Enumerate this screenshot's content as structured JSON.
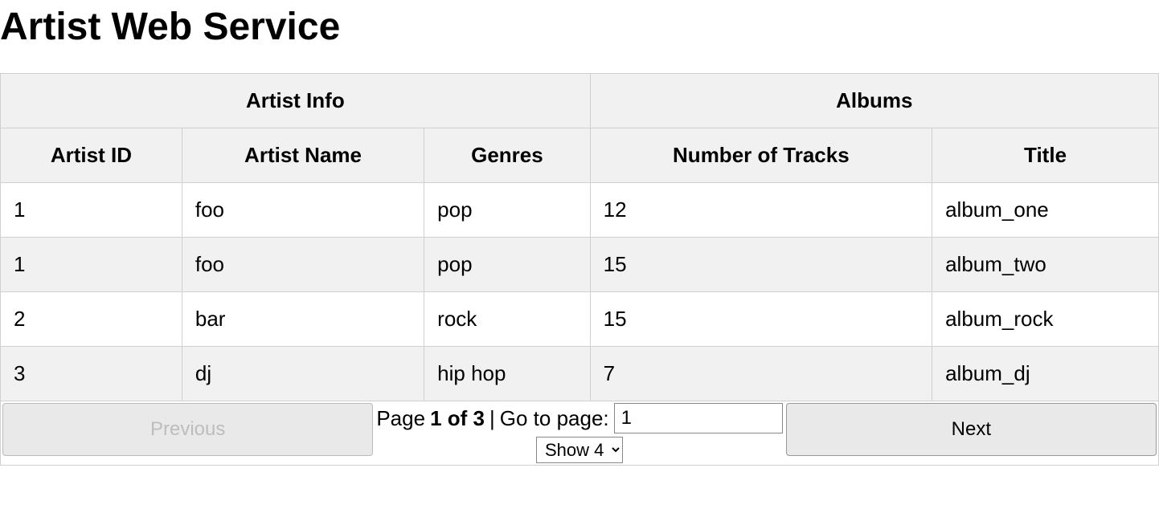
{
  "title": "Artist Web Service",
  "table": {
    "groupHeaders": [
      "Artist Info",
      "Albums"
    ],
    "columns": [
      "Artist ID",
      "Artist Name",
      "Genres",
      "Number of Tracks",
      "Title"
    ],
    "rows": [
      {
        "artist_id": "1",
        "artist_name": "foo",
        "genres": "pop",
        "tracks": "12",
        "title": "album_one"
      },
      {
        "artist_id": "1",
        "artist_name": "foo",
        "genres": "pop",
        "tracks": "15",
        "title": "album_two"
      },
      {
        "artist_id": "2",
        "artist_name": "bar",
        "genres": "rock",
        "tracks": "15",
        "title": "album_rock"
      },
      {
        "artist_id": "3",
        "artist_name": "dj",
        "genres": "hip hop",
        "tracks": "7",
        "title": "album_dj"
      }
    ]
  },
  "pagination": {
    "previous_label": "Previous",
    "next_label": "Next",
    "page_word": "Page",
    "page_current_total": "1 of 3",
    "separator": "|",
    "goto_label": "Go to page:",
    "goto_value": "1",
    "show_label": "Show 4"
  }
}
